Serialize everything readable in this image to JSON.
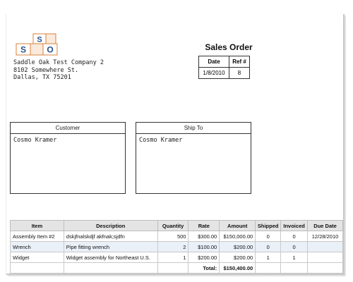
{
  "company": {
    "name": "Saddle Oak Test Company 2",
    "street": "8102 Somewhere St.",
    "city_line": "Dallas, TX 75201",
    "logo_letters": [
      "S",
      "O",
      "S"
    ],
    "accent": "#d9823b",
    "letter_color": "#2a4f8a"
  },
  "document": {
    "title": "Sales Order",
    "meta_headers": [
      "Date",
      "Ref #"
    ],
    "date": "1/8/2010",
    "ref": "8"
  },
  "customer": {
    "label": "Customer",
    "name": "Cosmo Kramer"
  },
  "ship_to": {
    "label": "Ship To",
    "name": "Cosmo Kramer"
  },
  "items": {
    "headers": [
      "Item",
      "Description",
      "Quantity",
      "Rate",
      "Amount",
      "Shipped",
      "Invoiced",
      "Due Date"
    ],
    "rows": [
      {
        "item": "Assembly Item #2",
        "description": "dskjfnalskdjf akfnak;sjdfn",
        "quantity": "500",
        "rate": "$300.00",
        "amount": "$150,000.00",
        "shipped": "0",
        "invoiced": "0",
        "due_date": "12/28/2010"
      },
      {
        "item": "Wrench",
        "description": "Pipe fitting wrench",
        "quantity": "2",
        "rate": "$100.00",
        "amount": "$200.00",
        "shipped": "0",
        "invoiced": "0",
        "due_date": ""
      },
      {
        "item": "Widget",
        "description": "Widget assembly for Northeast U.S.",
        "quantity": "1",
        "rate": "$200.00",
        "amount": "$200.00",
        "shipped": "1",
        "invoiced": "1",
        "due_date": ""
      }
    ],
    "total_label": "Total:",
    "total_value": "$150,400.00"
  }
}
